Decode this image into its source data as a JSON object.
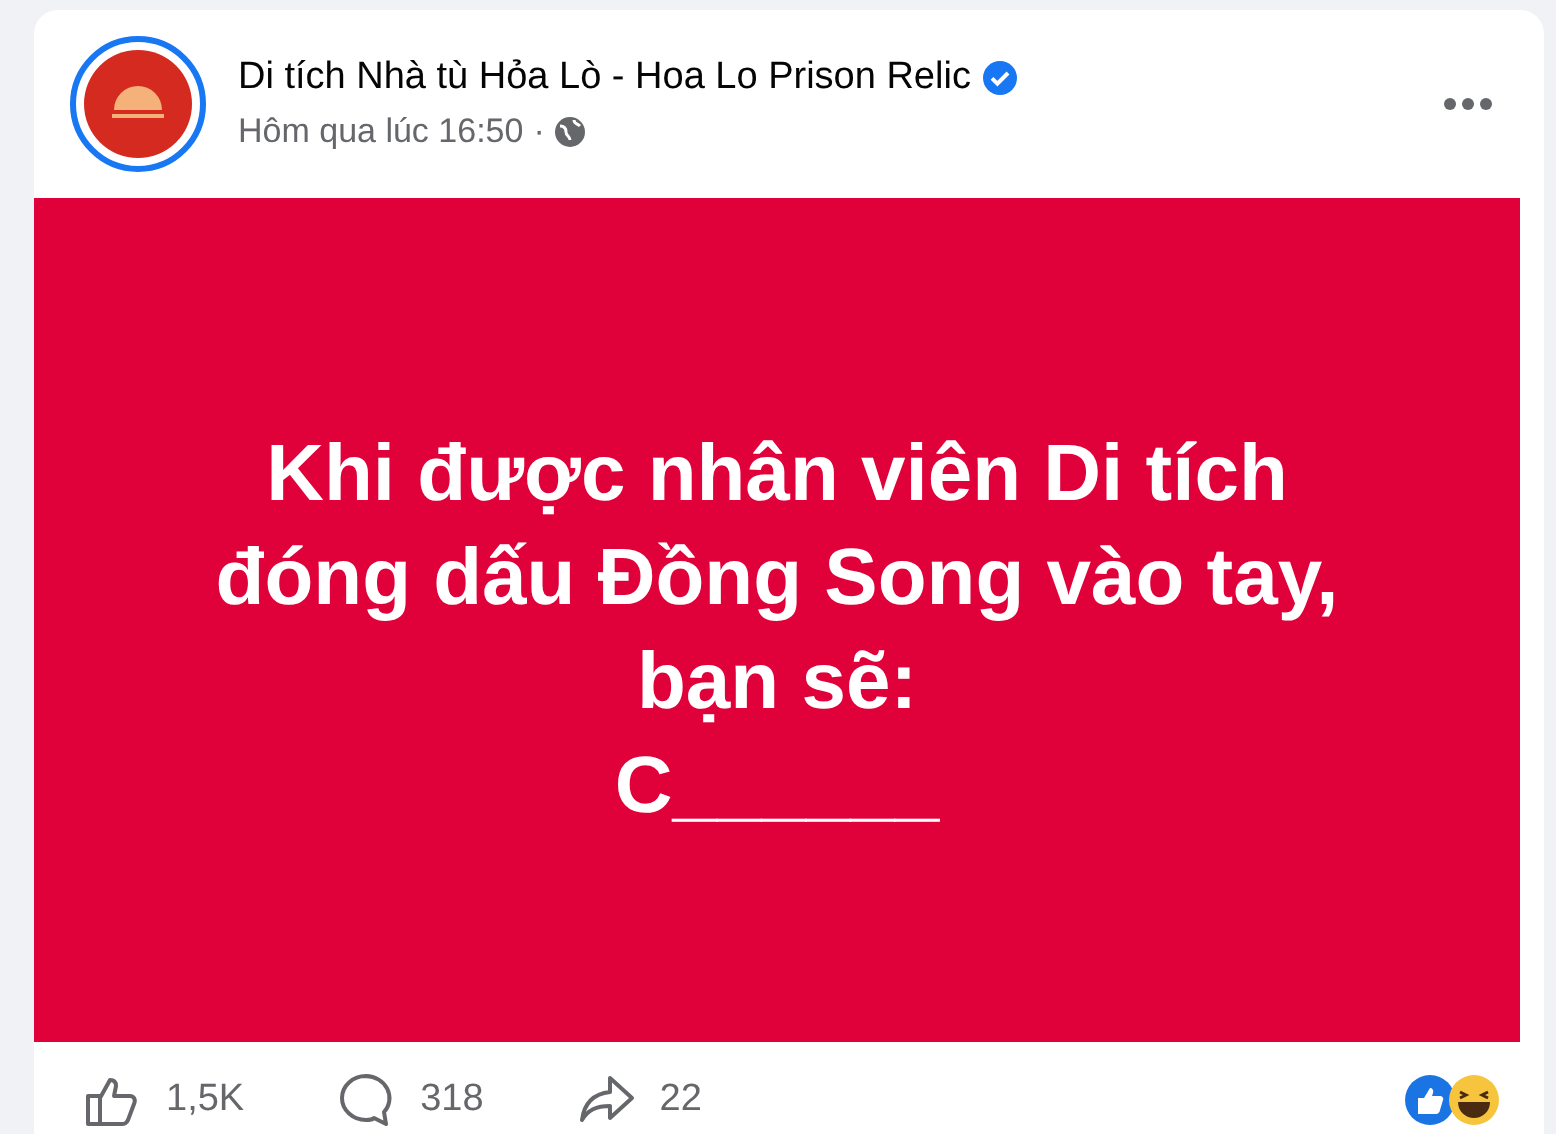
{
  "post": {
    "page_name": "Di tích Nhà tù Hỏa Lò - Hoa Lo Prison Relic",
    "verified": true,
    "time": "Hôm qua lúc 16:50",
    "separator": "·"
  },
  "content": {
    "lines": [
      "Khi được nhân viên Di tích",
      "đóng dấu Đồng Song vào tay,",
      "bạn sẽ:",
      "C______"
    ]
  },
  "stats": {
    "likes": "1,5K",
    "comments": "318",
    "shares": "22"
  }
}
